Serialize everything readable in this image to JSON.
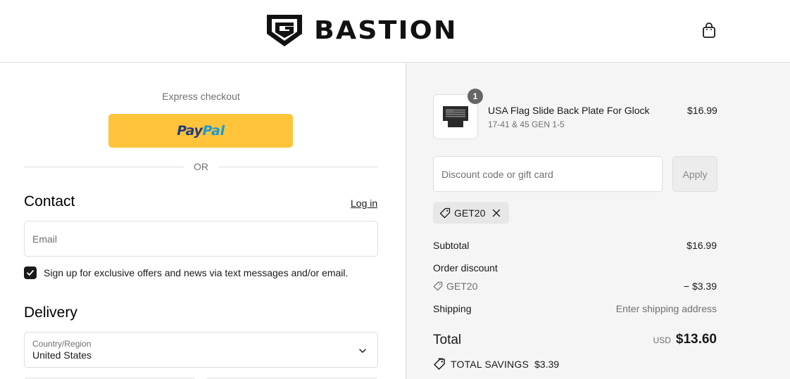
{
  "brand": {
    "name": "BASTION"
  },
  "header": {
    "cart_icon": "shopping-bag-icon"
  },
  "express": {
    "label": "Express checkout",
    "paypal_pay": "Pay",
    "paypal_pal": "Pal",
    "paypal_color": "#ffc439",
    "or_label": "OR"
  },
  "contact": {
    "title": "Contact",
    "login_label": "Log in",
    "email_placeholder": "Email",
    "email_value": "",
    "marketing_opt_in": true,
    "marketing_label": "Sign up for exclusive offers and news via text messages and/or email."
  },
  "delivery": {
    "title": "Delivery",
    "country_caption": "Country/Region",
    "country_value": "United States"
  },
  "cart": {
    "item": {
      "quantity": "1",
      "name": "USA Flag Slide Back Plate For Glock",
      "variant": "17-41 & 45 GEN 1-5",
      "price": "$16.99"
    },
    "discount_placeholder": "Discount code or gift card",
    "discount_value": "",
    "apply_label": "Apply",
    "applied_code": "GET20"
  },
  "summary": {
    "subtotal_label": "Subtotal",
    "subtotal_value": "$16.99",
    "order_discount_label": "Order discount",
    "discount_code": "GET20",
    "discount_amount": "− $3.39",
    "shipping_label": "Shipping",
    "shipping_value": "Enter shipping address",
    "total_label": "Total",
    "currency": "USD",
    "total_value": "$13.60",
    "savings_label": "TOTAL SAVINGS",
    "savings_value": "$3.39"
  }
}
